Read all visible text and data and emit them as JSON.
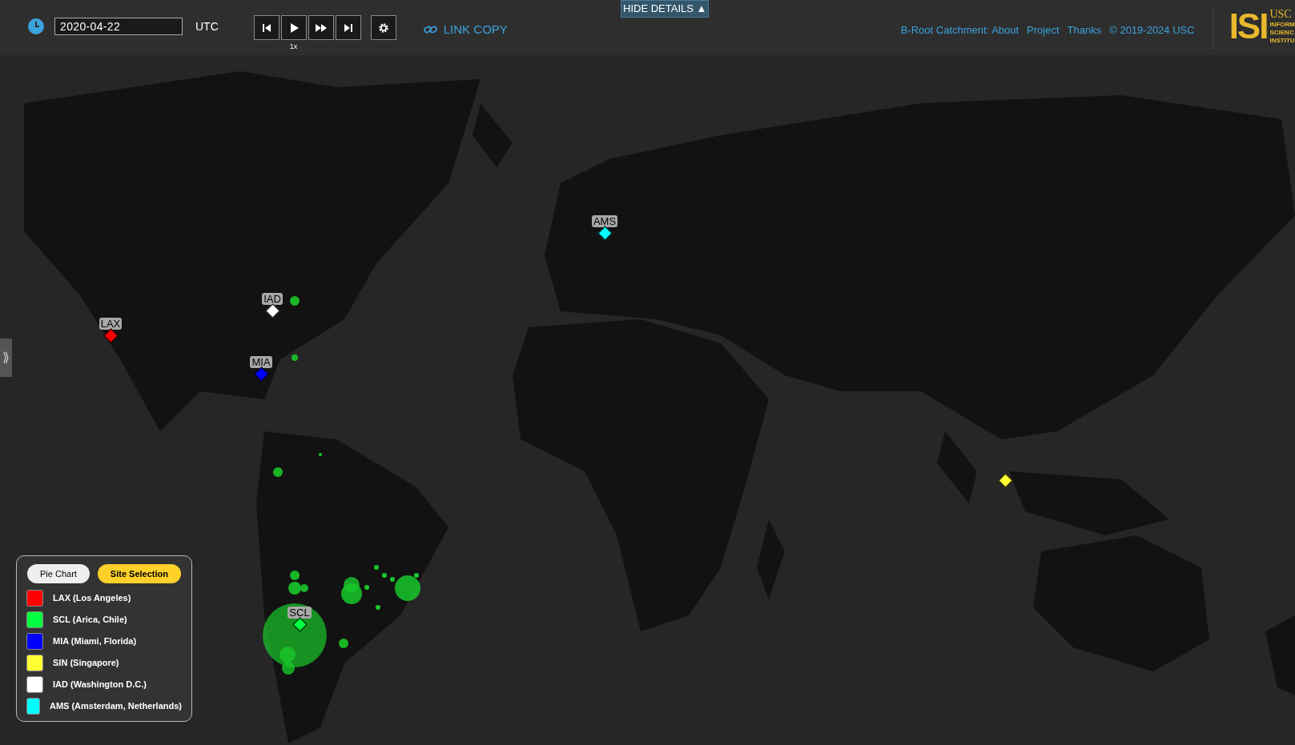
{
  "toolbar": {
    "date": "2020-04-22",
    "timezone": "UTC",
    "speed": "1x",
    "link_copy": "LINK COPY",
    "hide_details": "HIDE DETAILS ▲"
  },
  "header_links": [
    "B-Root Catchment: About",
    "Project",
    "Thanks",
    "© 2019-2024 USC"
  ],
  "logo": {
    "mark": "ISI",
    "lines": [
      "USC",
      "INFORM",
      "SCIENC",
      "INSTITU"
    ]
  },
  "side_toggle": "⟫",
  "legend": {
    "modes": [
      {
        "label": "Pie Chart",
        "selected": false
      },
      {
        "label": "Site Selection",
        "selected": true
      }
    ],
    "sites": [
      {
        "name": "LAX (Los Angeles)",
        "color": "#ff0000",
        "marker": "LAX"
      },
      {
        "name": "SCL (Arica, Chile)",
        "color": "#00ff40",
        "marker": "SCL"
      },
      {
        "name": "MIA (Miami, Florida)",
        "color": "#0000ff",
        "marker": "MIA"
      },
      {
        "name": "SIN (Singapore)",
        "color": "#ffff33"
      },
      {
        "name": "IAD (Washington D.C.)",
        "color": "#ffffff",
        "marker": "IAD"
      },
      {
        "name": "AMS (Amsterdam, Netherlands)",
        "color": "#00ffff",
        "marker": "AMS"
      }
    ]
  }
}
